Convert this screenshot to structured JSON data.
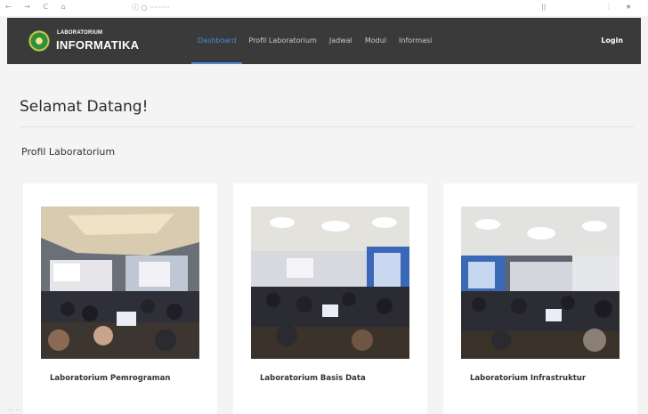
{
  "browser": {
    "nav_glyphs": "← → C ⌂",
    "url_text": "ⓘ ○ ·········"
  },
  "navbar": {
    "brand_small": "LABORATORIUM",
    "brand_big": "INFORMATIKA",
    "menu": [
      {
        "label": "Dashboard",
        "active": true
      },
      {
        "label": "Profil Laboratorium",
        "active": false
      },
      {
        "label": "Jadwal",
        "active": false
      },
      {
        "label": "Modul",
        "active": false
      },
      {
        "label": "Informasi",
        "active": false
      }
    ],
    "login_label": "Login"
  },
  "main": {
    "welcome_title": "Selamat Datang!",
    "section_title": "Profil Laboratorium",
    "cards": [
      {
        "title": "Laboratorium Pemrograman"
      },
      {
        "title": "Laboratorium Basis Data"
      },
      {
        "title": "Laboratorium Infrastruktur"
      }
    ]
  },
  "colors": {
    "navbar_bg": "#3a3a3a",
    "accent": "#4a8bd6",
    "page_bg": "#f4f4f4"
  },
  "icons": {
    "logo": "lab-emblem-icon"
  }
}
